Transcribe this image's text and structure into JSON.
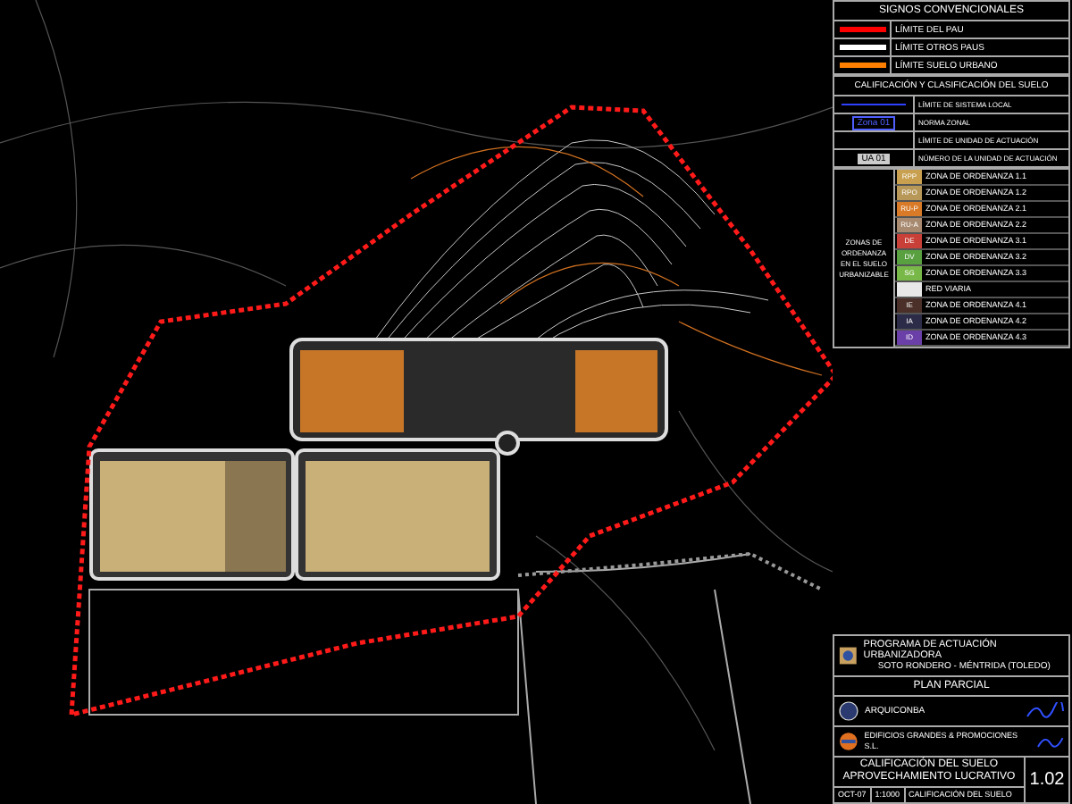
{
  "legend": {
    "title": "SIGNOS CONVENCIONALES",
    "lines": [
      {
        "label": "LÍMITE DEL PAU",
        "color": "#ff0000"
      },
      {
        "label": "LÍMITE OTROS PAUS",
        "color": "#ffffff"
      },
      {
        "label": "LÍMITE SUELO URBANO",
        "color": "#ff8000"
      }
    ]
  },
  "classification": {
    "title": "CALIFICACIÓN Y CLASIFICACIÓN DEL SUELO",
    "symbols": [
      {
        "kind": "line",
        "label": "LÍMITE DE SISTEMA LOCAL"
      },
      {
        "kind": "tag",
        "code": "Zona 01",
        "label": "NORMA ZONAL"
      },
      {
        "kind": "blank",
        "label": "LÍMITE DE UNIDAD DE ACTUACIÓN"
      },
      {
        "kind": "ua",
        "code": "UA 01",
        "label": "NÚMERO DE LA UNIDAD DE ACTUACIÓN"
      }
    ],
    "group_label": "ZONAS DE ORDENANZA EN EL SUELO URBANIZABLE",
    "zones": [
      {
        "code": "RPP",
        "color": "#c8a050",
        "label": "ZONA DE ORDENANZA 1.1"
      },
      {
        "code": "RPO",
        "color": "#b89858",
        "label": "ZONA DE ORDENANZA 1.2"
      },
      {
        "code": "RU-P",
        "color": "#d87a28",
        "label": "ZONA DE ORDENANZA 2.1"
      },
      {
        "code": "RU-A",
        "color": "#a88a70",
        "label": "ZONA DE ORDENANZA 2.2"
      },
      {
        "code": "DE",
        "color": "#c84038",
        "label": "ZONA DE ORDENANZA 3.1"
      },
      {
        "code": "DV",
        "color": "#58a040",
        "label": "ZONA DE ORDENANZA 3.2"
      },
      {
        "code": "SG",
        "color": "#78b848",
        "label": "ZONA DE ORDENANZA 3.3"
      },
      {
        "color": "#e8e8e8",
        "label": "RED VIARIA"
      },
      {
        "code": "IE",
        "color": "#4a3028",
        "label": "ZONA DE ORDENANZA 4.1"
      },
      {
        "code": "IA",
        "color": "#2c2c48",
        "label": "ZONA DE ORDENANZA 4.2"
      },
      {
        "code": "ID",
        "color": "#6a40a8",
        "label": "ZONA DE ORDENANZA 4.3"
      }
    ]
  },
  "title_block": {
    "project": "PROGRAMA DE ACTUACIÓN URBANIZADORA",
    "place": "SOTO RONDERO - MÉNTRIDA (TOLEDO)",
    "phase": "PLAN PARCIAL",
    "author": "ARQUICONBA",
    "promoter": "EDIFICIOS GRANDES & PROMOCIONES S.L.",
    "plan_title": [
      "CALIFICACIÓN DEL SUELO",
      "APROVECHAMIENTO LUCRATIVO"
    ],
    "date": "OCT-07",
    "scale": "1:1000",
    "sheet_name": "CALIFICACIÓN DEL SUELO",
    "number": "1.02"
  }
}
